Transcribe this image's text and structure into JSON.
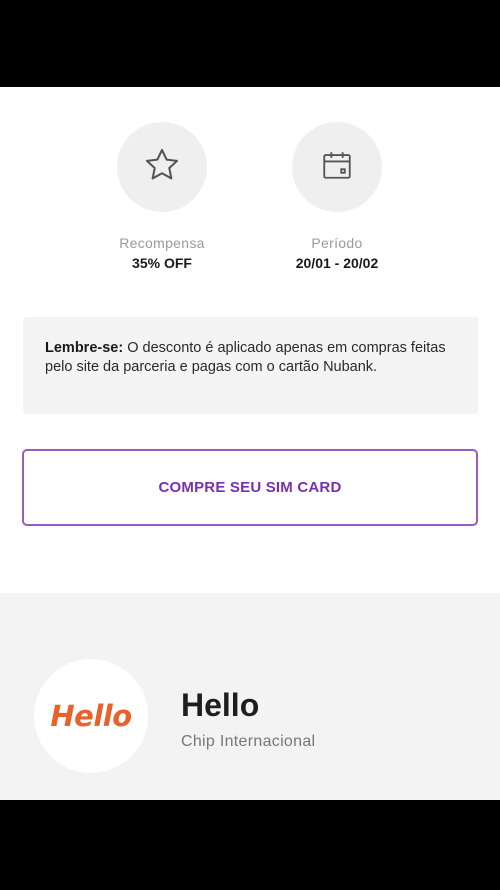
{
  "reward": {
    "label": "Recompensa",
    "value": "35% OFF",
    "icon": "star-icon"
  },
  "period": {
    "label": "Período",
    "value": "20/01 - 20/02",
    "icon": "calendar-icon"
  },
  "reminder": {
    "prefix": "Lembre-se:",
    "text": " O desconto é aplicado apenas em compras feitas pelo site da parceria e pagas com o cartão Nubank."
  },
  "cta": {
    "label": "COMPRE SEU SIM CARD"
  },
  "partner": {
    "logo_text": "Hello",
    "name": "Hello",
    "subtitle": "Chip Internacional"
  },
  "colors": {
    "accent": "#7a2fb3",
    "border": "#9b59c9",
    "logo": "#e8632b"
  }
}
